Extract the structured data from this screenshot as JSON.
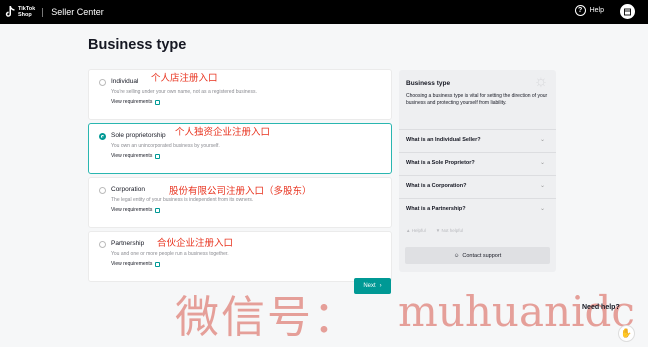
{
  "topbar": {
    "logo_line1": "TikTok",
    "logo_line2": "Shop",
    "app_title": "Seller Center",
    "help_label": "Help",
    "help_icon_glyph": "?"
  },
  "page": {
    "title": "Business type"
  },
  "options": [
    {
      "title": "Individual",
      "description": "You're selling under your own name, not as a registered business.",
      "link": "View requirements",
      "annotation": "个人店注册入口",
      "selected": false
    },
    {
      "title": "Sole proprietorship",
      "description": "You own an unincorporated business by yourself.",
      "link": "View requirements",
      "annotation": "个人独资企业注册入口",
      "selected": true
    },
    {
      "title": "Corporation",
      "description": "The legal entity of your business is independent from its owners.",
      "link": "View requirements",
      "annotation": "股份有限公司注册入口（多股东）",
      "selected": false
    },
    {
      "title": "Partnership",
      "description": "You and one or more people run a business together.",
      "link": "View requirements",
      "annotation": "合伙企业注册入口",
      "selected": false
    }
  ],
  "next_button": {
    "label": "Next"
  },
  "sidebar": {
    "title": "Business type",
    "description": "Choosing a business type is vital for setting the direction of your business and protecting yourself from liability.",
    "faqs": [
      "What is an Individual Seller?",
      "What is a Sole Proprietor?",
      "What is a Corporation?",
      "What is a Partnership?"
    ],
    "helpful_label": "Helpful",
    "not_helpful_label": "Not helpful",
    "contact_label": "Contact support"
  },
  "watermark": {
    "cn": "微信号：",
    "latin": "muhuanidc"
  },
  "need_help": "Need help?",
  "colors": {
    "accent": "#009995",
    "annotation": "#e8331f",
    "topbar": "#000000"
  },
  "icons": [
    "tiktok-logo-icon",
    "help-icon",
    "user-icon",
    "external-link-icon",
    "bulb-icon",
    "chevron-down-icon",
    "thumbs-up-icon",
    "thumbs-down-icon",
    "chat-icon",
    "hand-icon"
  ]
}
